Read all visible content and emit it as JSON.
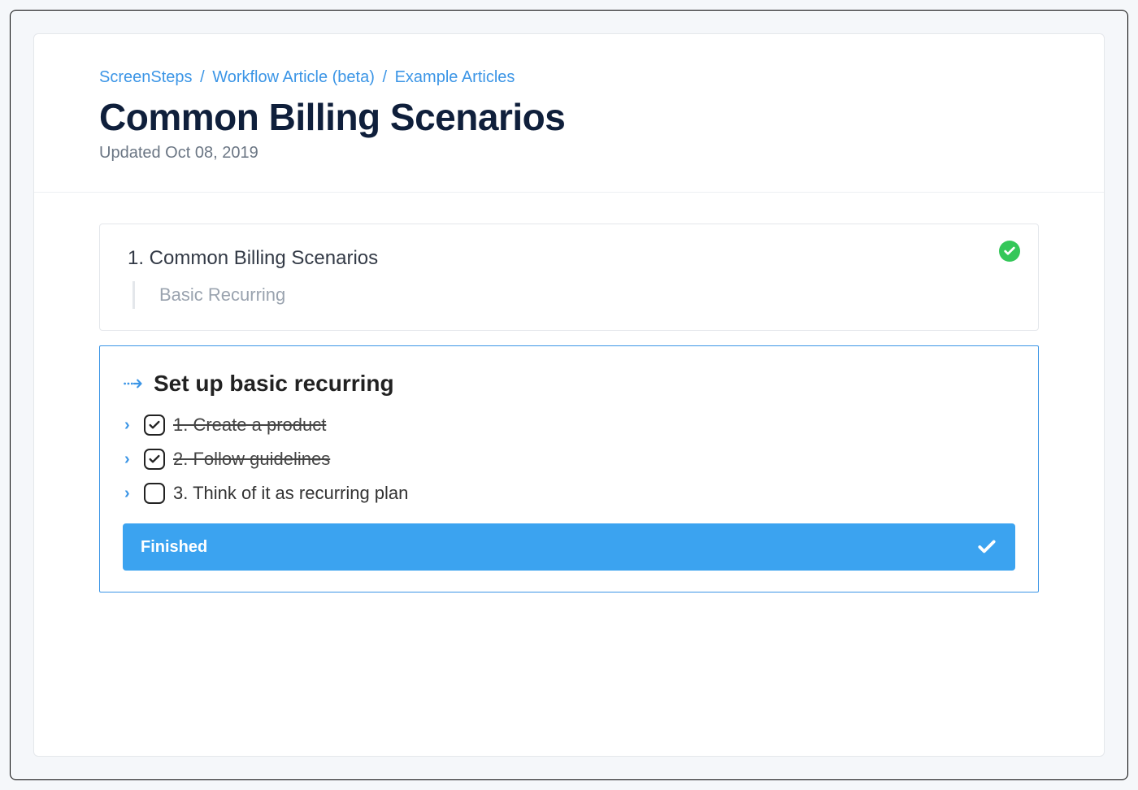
{
  "breadcrumb": {
    "items": [
      "ScreenSteps",
      "Workflow Article (beta)",
      "Example Articles"
    ]
  },
  "page": {
    "title": "Common Billing Scenarios",
    "updated": "Updated Oct 08, 2019"
  },
  "progress": {
    "title": "1. Common Billing Scenarios",
    "subtitle": "Basic Recurring"
  },
  "workflow": {
    "title": "Set up basic recurring",
    "steps": [
      {
        "label": "1. Create a product",
        "checked": true
      },
      {
        "label": "2. Follow guidelines",
        "checked": true
      },
      {
        "label": "3. Think of it as recurring plan",
        "checked": false
      }
    ],
    "finished_label": "Finished"
  }
}
